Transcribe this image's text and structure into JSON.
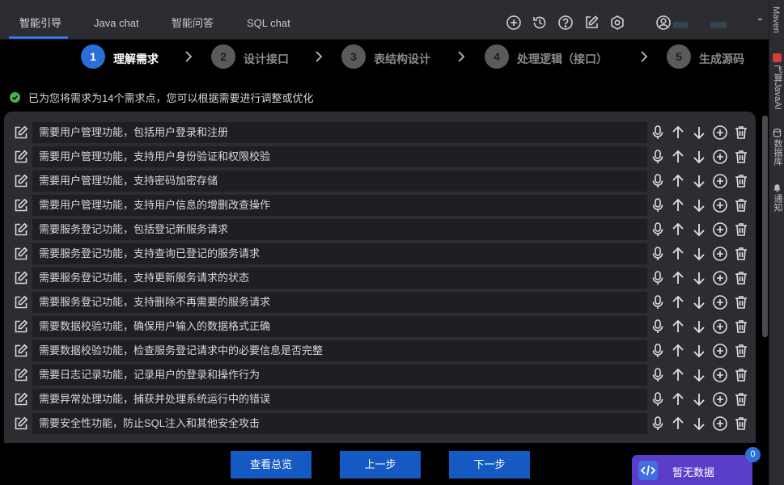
{
  "tabs": [
    {
      "label": "智能引导",
      "active": true
    },
    {
      "label": "Java chat",
      "active": false
    },
    {
      "label": "智能问答",
      "active": false
    },
    {
      "label": "SQL chat",
      "active": false
    }
  ],
  "toolbar_icons": [
    "add-circle-icon",
    "history-icon",
    "help-icon",
    "edit-icon",
    "settings-icon",
    "user-icon"
  ],
  "right_tools": [
    {
      "label": "Maven",
      "icon": "maven-icon"
    },
    {
      "label": "飞算JavaAI",
      "icon": "javaai-icon"
    },
    {
      "label": "数据库",
      "icon": "database-icon"
    },
    {
      "label": "通知",
      "icon": "bell-icon"
    }
  ],
  "steps": [
    {
      "number": "1",
      "label": "理解需求",
      "active": true
    },
    {
      "number": "2",
      "label": "设计接口",
      "active": false
    },
    {
      "number": "3",
      "label": "表结构设计",
      "active": false
    },
    {
      "number": "4",
      "label": "处理逻辑（接口）",
      "active": false
    },
    {
      "number": "5",
      "label": "生成源码",
      "active": false
    }
  ],
  "notice": {
    "text": "已为您将需求为14个需求点，您可以根据需要进行调整或优化",
    "icon": "check-circle-icon"
  },
  "requirements": [
    "需要用户管理功能，包括用户登录和注册",
    "需要用户管理功能，支持用户身份验证和权限校验",
    "需要用户管理功能，支持密码加密存储",
    "需要用户管理功能，支持用户信息的增删改查操作",
    "需要服务登记功能，包括登记新服务请求",
    "需要服务登记功能，支持查询已登记的服务请求",
    "需要服务登记功能，支持更新服务请求的状态",
    "需要服务登记功能，支持删除不再需要的服务请求",
    "需要数据校验功能，确保用户输入的数据格式正确",
    "需要数据校验功能，检查服务登记请求中的必要信息是否完整",
    "需要日志记录功能，记录用户的登录和操作行为",
    "需要异常处理功能，捕获并处理系统运行中的错误",
    "需要安全性功能，防止SQL注入和其他安全攻击"
  ],
  "row_actions": [
    "microphone-icon",
    "arrow-up-icon",
    "arrow-down-icon",
    "add-circle-icon",
    "trash-icon"
  ],
  "buttons": {
    "overview": "查看总览",
    "prev": "上一步",
    "next": "下一步"
  },
  "widget": {
    "text": "暂无数据",
    "badge": "0"
  },
  "colors": {
    "accent": "#3574f0",
    "button": "#1559c2",
    "success": "#4caf50",
    "widget": "#5a3dc8"
  }
}
